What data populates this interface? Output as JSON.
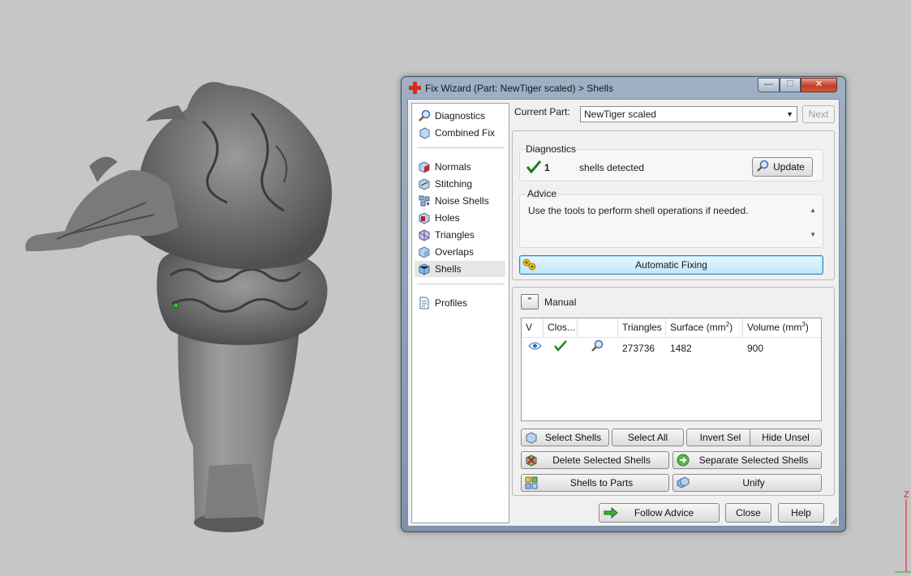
{
  "window": {
    "title": "Fix Wizard (Part: NewTiger scaled) > Shells",
    "minimize_glyph": "—",
    "maximize_glyph": "☐",
    "close_glyph": "✕"
  },
  "nav": {
    "top_items": [
      {
        "label": "Diagnostics",
        "icon": "magnifier-icon"
      },
      {
        "label": "Combined Fix",
        "icon": "cube-icon"
      }
    ],
    "tool_items": [
      {
        "label": "Normals",
        "icon": "normals-cube-icon"
      },
      {
        "label": "Stitching",
        "icon": "stitching-cube-icon"
      },
      {
        "label": "Noise Shells",
        "icon": "noise-shells-icon"
      },
      {
        "label": "Holes",
        "icon": "holes-cube-icon"
      },
      {
        "label": "Triangles",
        "icon": "triangles-cube-icon"
      },
      {
        "label": "Overlaps",
        "icon": "overlaps-cube-icon"
      },
      {
        "label": "Shells",
        "icon": "shells-cube-icon",
        "selected": true
      }
    ],
    "profiles": {
      "label": "Profiles",
      "icon": "document-icon"
    }
  },
  "current_part": {
    "label": "Current Part:",
    "value": "NewTiger scaled",
    "next_label": "Next"
  },
  "diagnostics": {
    "title": "Diagnostics",
    "count": "1",
    "text": "shells detected",
    "update_label": "Update"
  },
  "advice": {
    "title": "Advice",
    "text": "Use the tools to perform shell operations if needed."
  },
  "automatic_fixing_label": "Automatic Fixing",
  "manual": {
    "title": "Manual",
    "collapse_glyph": "⌃",
    "table": {
      "columns": [
        "V",
        "Clos...",
        "",
        "Triangles",
        "Surface (mm",
        "Volume (mm"
      ],
      "unit_exponents": [
        "2",
        "3"
      ],
      "rows": [
        {
          "visible": true,
          "closed": true,
          "triangles": "273736",
          "surface": "1482",
          "volume": "900"
        }
      ]
    },
    "buttons": {
      "select_shells": "Select Shells",
      "select_all": "Select All",
      "invert_sel": "Invert Sel",
      "hide_unsel": "Hide Unsel",
      "delete_selected": "Delete Selected Shells",
      "separate_selected": "Separate Selected Shells",
      "shells_to_parts": "Shells to Parts",
      "unify": "Unify"
    }
  },
  "footer": {
    "follow_advice": "Follow Advice",
    "close": "Close",
    "help": "Help"
  },
  "axis_label": "Z",
  "colors": {
    "check_green": "#1e7a1e",
    "window_frame": "#8ea1b7",
    "close_red": "#c13f25",
    "auto_fix_blue": "#bee6fd"
  }
}
